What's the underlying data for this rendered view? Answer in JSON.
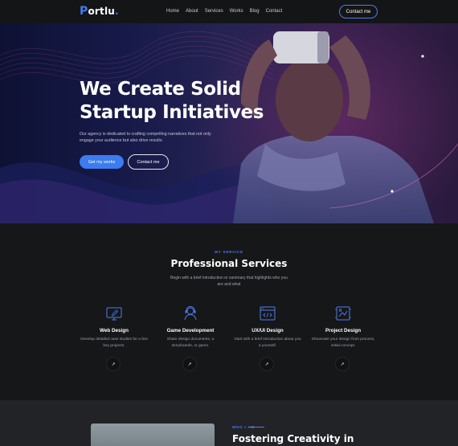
{
  "nav": {
    "logo": "Portlu",
    "links": [
      "Home",
      "About",
      "Services",
      "Works",
      "Blog",
      "Contact"
    ],
    "contact_label": "Contact me"
  },
  "hero": {
    "title_line1": "We Create Solid",
    "title_line2": "Startup Initiatives",
    "description": "Our agency is dedicated to crafting compelling narratives that not only engage your audience but also drive results.",
    "primary_cta": "Get my works",
    "secondary_cta": "Contact me"
  },
  "services": {
    "eyebrow": "MY SERVICE",
    "title": "Professional Services",
    "subtitle": "Begin with a brief introduction or summary that highlights who you are and what",
    "items": [
      {
        "name": "Web Design",
        "desc": "Develop detailed case studies for a few key projects.",
        "icon": "web-design-icon"
      },
      {
        "name": "Game Development",
        "desc": "Share design documents, a storyboards, or game.",
        "icon": "game-development-icon"
      },
      {
        "name": "UX/UI Design",
        "desc": "Start with a brief introduction about you a yourself.",
        "icon": "ux-ui-design-icon"
      },
      {
        "name": "Project Design",
        "desc": "Showcase your design from process, initial concept.",
        "icon": "project-design-icon"
      }
    ],
    "arrow_glyph": "↗"
  },
  "about": {
    "eyebrow": "WHO I AM",
    "title": "Fostering Creativity in"
  },
  "colors": {
    "accent": "#3c7cf0",
    "background": "#161719",
    "nav": "#141517"
  }
}
